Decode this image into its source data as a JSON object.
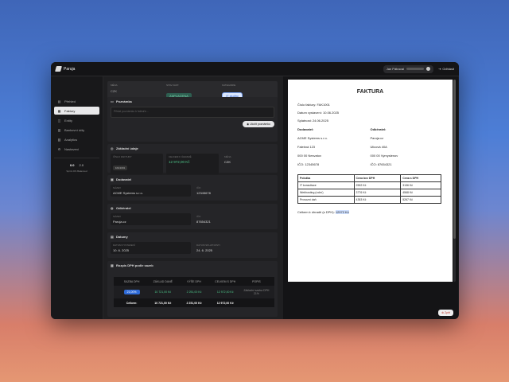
{
  "app": {
    "name": "Paruja"
  },
  "topbar": {
    "user": "Jan Pátraval",
    "logout": "Odhlásit"
  },
  "sidebar": {
    "items": [
      {
        "label": "Přehled",
        "icon": "chart-icon"
      },
      {
        "label": "Faktury",
        "icon": "invoice-icon"
      },
      {
        "label": "Entity",
        "icon": "entity-icon"
      },
      {
        "label": "Bankovní účty",
        "icon": "bank-icon"
      },
      {
        "label": "Analytics",
        "icon": "analytics-icon"
      },
      {
        "label": "Nastavení",
        "icon": "settings-icon"
      }
    ],
    "version_a": "0.0",
    "version_b": "2.0",
    "sub": "Sprint DS Balanced"
  },
  "header": {
    "col1_label": "MĚNA",
    "col1_value": "CZK",
    "col2_label": "STAV FAKT.",
    "col2_value": "ZAPLACENA",
    "col3_label": "KATEGORIE",
    "col3_value": "IT služby"
  },
  "note": {
    "title": "Poznámka",
    "placeholder": "Přidat poznámku k faktuře...",
    "button": "Uložit poznámku"
  },
  "basic": {
    "title": "Základní údaje",
    "c1_label": "ČÍSLO FAKTURY",
    "c1_value": "FAK1001",
    "c2_label": "CELKEM K ÚHRADĚ",
    "c2_value": "12 972,00 Kč",
    "c3_label": "MĚNA",
    "c3_value": "CZK"
  },
  "supplier": {
    "title": "Dodavatel",
    "name_label": "NÁZEV",
    "name": "ACME Systems s.r.o.",
    "ico_label": "IČO",
    "ico": "12345678"
  },
  "customer": {
    "title": "Odběratel",
    "name_label": "NÁZEV",
    "name": "Paruja.cz",
    "ico_label": "IČO",
    "ico": "87654321"
  },
  "dates": {
    "title": "Datumy",
    "d1_label": "DATUM VYSTAVENÍ",
    "d1": "10. 6. 2025",
    "d2_label": "DATUM SPLATNOSTI",
    "d2": "24. 6. 2025"
  },
  "vat": {
    "title": "Rozpis DPH podle sazeb",
    "headers": [
      "SAZBA DPH",
      "ZÁKLAD DANĚ",
      "VÝŠE DPH",
      "CELKEM S DPH",
      "POPIS"
    ],
    "rows": [
      {
        "rate": "21,00%",
        "base": "10 721,00 Kč",
        "vat": "2 251,00 Kč",
        "total": "12 972,00 Kč",
        "desc": "Základní sazba DPH 21%"
      }
    ],
    "total_label": "Celkem:",
    "total_base": "10 721,00 Kč",
    "total_vat": "2 251,00 Kč",
    "total_total": "12 972,00 Kč"
  },
  "invoice": {
    "title": "FAKTURA",
    "number": "Číslo faktury: FAK1001",
    "issued": "Datum vystavení: 10.06.2025",
    "due": "Splatnost: 24.06.2025",
    "supplier_h": "Dodavatel:",
    "supplier_lines": [
      "ACME Systems s.r.o.",
      "Falešná 123",
      "000 00 Nesvatov",
      "IČO: 12345678"
    ],
    "customer_h": "Odběratel:",
    "customer_lines": [
      "Paruja.cz",
      "Ulicová 40A",
      "000 00 Vymyslenov",
      "IČO: 87654321"
    ],
    "table_headers": [
      "Položka",
      "Cena bez DPH",
      "Cena s DPH"
    ],
    "table_rows": [
      [
        "IT konzultace",
        "2592 Kč",
        "3136 Kč"
      ],
      [
        "Webhosting (roční)",
        "3776 Kč",
        "4568 Kč"
      ],
      [
        "Provozní daň",
        "4353 Kč",
        "5267 Kč"
      ]
    ],
    "total_text": "Celkem k úhradě (s DPH):",
    "total_value": "12972 Kč"
  },
  "back_button": "Zpět"
}
